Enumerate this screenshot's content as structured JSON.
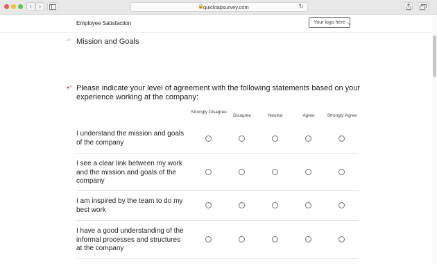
{
  "browser": {
    "url": "quicktapsurvey.com",
    "back_icon": "‹",
    "forward_icon": "›",
    "reload_icon": "↻",
    "new_tab_icon": "+"
  },
  "header": {
    "survey_title": "Employee Satisfaction",
    "logo_placeholder": "Your logo here"
  },
  "section": {
    "title": "Mission and Goals"
  },
  "question": {
    "text": "Please indicate your level of agreement with the following statements based on your experience working at the company:",
    "required_marker": "●*",
    "columns": [
      "Strongly Disagree",
      "Disagree",
      "Neutral",
      "Agree",
      "Strongly Agree"
    ],
    "rows": [
      "I understand the mission and goals of the company",
      "I see a clear link between my work and the mission and goals of the company",
      "I am inspired by the team to do my best work",
      "I have a good understanding of the informal processes and structures at the company"
    ]
  },
  "colors": {
    "required": "#e04a3f",
    "radio_border": "#6f6f6f"
  }
}
